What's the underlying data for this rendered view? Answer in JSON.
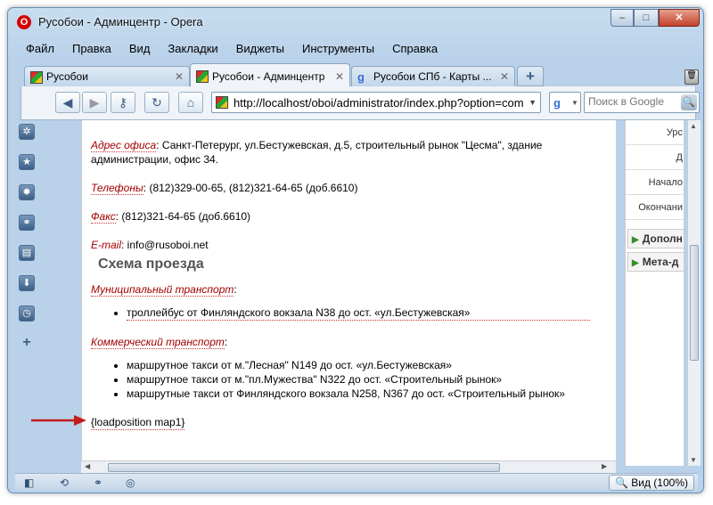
{
  "window": {
    "title": "Русобои - Админцентр - Opera",
    "logo_text": "O"
  },
  "window_controls": {
    "minimize": "–",
    "maximize": "□",
    "close": "✕"
  },
  "menu": [
    "Файл",
    "Правка",
    "Вид",
    "Закладки",
    "Виджеты",
    "Инструменты",
    "Справка"
  ],
  "tabs": [
    {
      "label": "Русобои"
    },
    {
      "label": "Русобои - Админцентр"
    },
    {
      "label": "Русобои СПб - Карты ..."
    }
  ],
  "tab_close": "✕",
  "new_tab": "+",
  "address": {
    "url": "http://localhost/oboi/administrator/index.php?option=com_c"
  },
  "search": {
    "engine": "g",
    "placeholder": "Поиск в Google"
  },
  "article": {
    "office_label": "Адрес офиса",
    "office_text": ": Санкт-Петерург, ул.Бестужевская, д.5, строительный рынок \"Цесма\", здание администрации, офис 34.",
    "phones_label": "Телефоны",
    "phones_text": ": (812)329-00-65, (812)321-64-65 (доб.6610)",
    "fax_label": "Факс",
    "fax_text": ": (812)321-64-65 (доб.6610)",
    "email_label": "E-mail",
    "email_text": ": info@rusoboi.net",
    "heading": "Схема проезда",
    "municipal_label": "Муниципальный транспорт",
    "municipal_items": [
      "троллейбус от Финляндского вокзала N38 до ост. «ул.Бестужевская»"
    ],
    "commercial_label": "Коммерческий транспорт",
    "commercial_items": [
      "маршрутное такси от м.\"Лесная\" N149 до ост. «ул.Бестужевская»",
      "маршрутное такси от м.\"пл.Мужества\" N322 до ост. «Строительный рынок»",
      "маршрутные такси от Финляндского вокзала N258, N367 до ост. «Строительный рынок»"
    ],
    "loadposition": "{loadposition map1}"
  },
  "right_panel": {
    "rows": [
      "Урс",
      "Д",
      "Начало",
      "Окончани"
    ],
    "sections": [
      "Дополн",
      "Мета-д"
    ]
  },
  "status": {
    "zoom": "Вид (100%)"
  },
  "colors": {
    "link_red": "#a30000",
    "arrow": "#c21d1d",
    "frame": "#b9d1e9"
  }
}
